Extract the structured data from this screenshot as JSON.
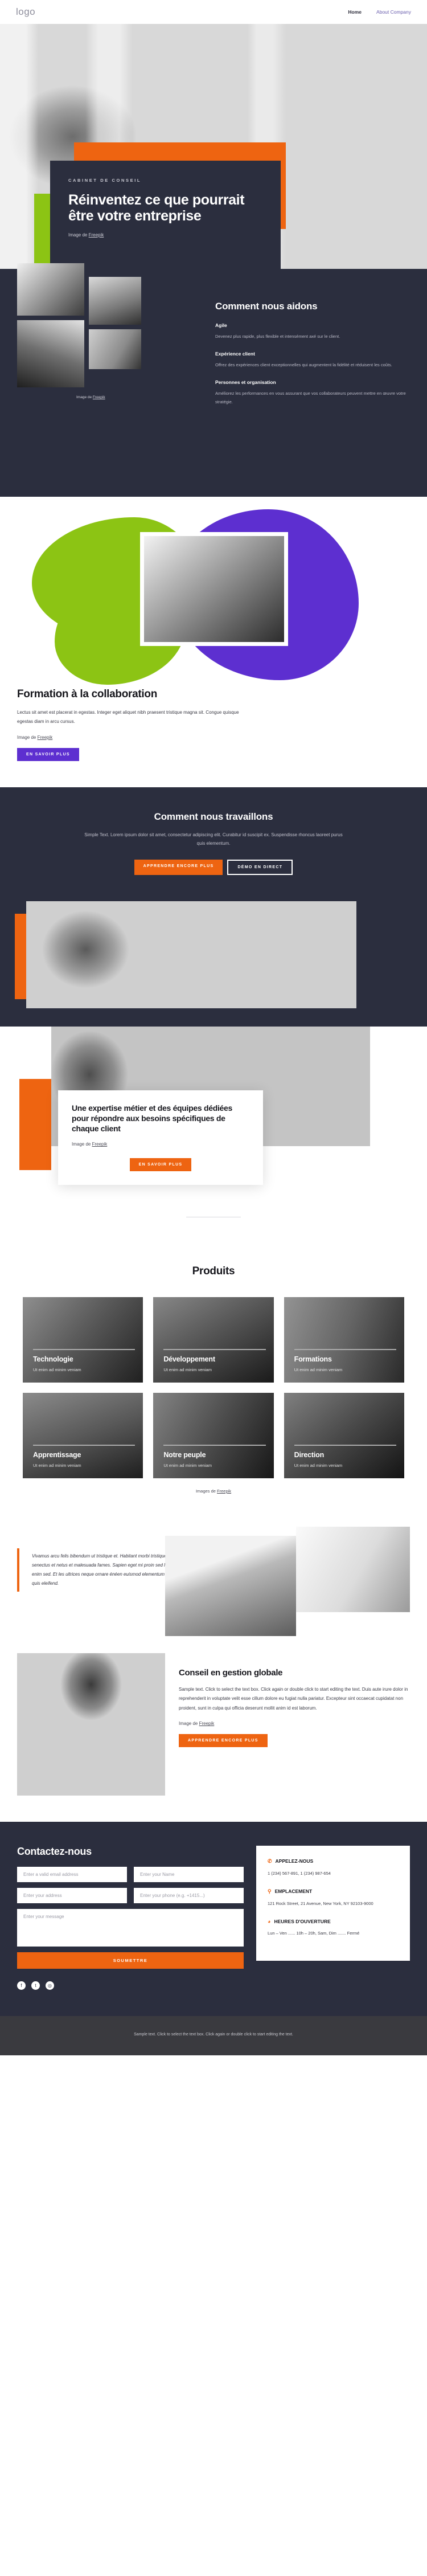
{
  "nav": {
    "logo": "logo",
    "links": [
      {
        "label": "Home"
      },
      {
        "label": "About Company"
      }
    ]
  },
  "hero": {
    "eyebrow": "CABINET DE CONSEIL",
    "title": "Réinventez ce que pourrait être votre entreprise",
    "credit_prefix": "Image de ",
    "credit_link": "Freepik"
  },
  "help": {
    "title": "Comment nous aidons",
    "credit_prefix": "Image de ",
    "credit_link": "Freepik",
    "features": [
      {
        "title": "Agile",
        "text": "Devenez plus rapide, plus flexible et intensément axé sur le client."
      },
      {
        "title": "Expérience client",
        "text": "Offrez des expériences client exceptionnelles qui augmentent la fidélité et réduisent les coûts."
      },
      {
        "title": "Personnes et organisation",
        "text": "Améliorez les performances en vous assurant que vos collaborateurs peuvent mettre en œuvre votre stratégie."
      }
    ]
  },
  "training": {
    "title": "Formation à la collaboration",
    "text": "Lectus sit amet est placerat in egestas. Integer eget aliquet nibh praesent tristique magna sit. Congue quisque egestas diam in arcu cursus.",
    "credit_prefix": "Image de ",
    "credit_link": "Freepik",
    "cta": "EN SAVOIR PLUS"
  },
  "work": {
    "title": "Comment nous travaillons",
    "lead": "Simple Text. Lorem ipsum dolor sit amet, consectetur adipiscing elit. Curabitur id suscipit ex. Suspendisse rhoncus laoreet purus quis elementum.",
    "cta_primary": "APPRENDRE ENCORE PLUS",
    "cta_secondary": "DÉMO EN DIRECT"
  },
  "expertise": {
    "title": "Une expertise métier et des équipes dédiées pour répondre aux besoins spécifiques de chaque client",
    "credit_prefix": "Image de ",
    "credit_link": "Freepik",
    "cta": "EN SAVOIR PLUS"
  },
  "products": {
    "title": "Produits",
    "credit_prefix": "Images de ",
    "credit_link": "Freepik",
    "items": [
      {
        "title": "Technologie",
        "text": "Ut enim ad minim veniam"
      },
      {
        "title": "Développement",
        "text": "Ut enim ad minim veniam"
      },
      {
        "title": "Formations",
        "text": "Ut enim ad minim veniam"
      },
      {
        "title": "Apprentissage",
        "text": "Ut enim ad minim veniam"
      },
      {
        "title": "Notre peuple",
        "text": "Ut enim ad minim veniam"
      },
      {
        "title": "Direction",
        "text": "Ut enim ad minim veniam"
      }
    ]
  },
  "quote": {
    "text": "Vivamus arcu felis bibendum ut tristique et. Habitant morbi tristique senectus et netus et malesuada fames. Sapien eget mi proin sed libero enim sed. Et les ultrices neque ornare énéen euismod elementum nisi quis eleifend."
  },
  "advice": {
    "title": "Conseil en gestion globale",
    "text": "Sample text. Click to select the text box. Click again or double click to start editing the text. Duis aute irure dolor in reprehenderit in voluptate velit esse cillum dolore eu fugiat nulla pariatur. Excepteur sint occaecat cupidatat non proident, sunt in culpa qui officia deserunt mollit anim id est laborum.",
    "credit_prefix": "Image de ",
    "credit_link": "Freepik",
    "cta": "APPRENDRE ENCORE PLUS"
  },
  "contact": {
    "title": "Contactez-nous",
    "fields": {
      "email_placeholder": "Enter a valid email address",
      "name_placeholder": "Enter your Name",
      "address_placeholder": "Enter your address",
      "phone_placeholder": "Enter your phone (e.g. +1415...)",
      "message_placeholder": "Enter your message"
    },
    "submit": "SOUMETTRE",
    "socials": [
      {
        "name": "facebook",
        "glyph": "f"
      },
      {
        "name": "twitter",
        "glyph": "t"
      },
      {
        "name": "instagram",
        "glyph": "◎"
      }
    ],
    "info": [
      {
        "icon": "phone-icon",
        "glyph": "✆",
        "title": "APPELEZ-NOUS",
        "value": "1 (234) 567-891, 1 (234) 987-654"
      },
      {
        "icon": "location-pin-icon",
        "glyph": "⚲",
        "title": "EMPLACEMENT",
        "value": "121 Rock Street, 21 Avenue, New York, NY 92103-9000"
      },
      {
        "icon": "clock-icon",
        "glyph": "◕",
        "title": "HEURES D'OUVERTURE",
        "value": "Lun – Ven ...... 10h – 20h, Sam, Dim ....... Fermé"
      }
    ]
  },
  "footer": {
    "text": "Sample text. Click to select the text box. Click again or double click to start editing the text."
  },
  "colors": {
    "orange": "#ee6411",
    "green": "#8cc414",
    "purple": "#5d2fd0",
    "dark": "#2b2e3e",
    "footer_dark": "#3a3a3f"
  }
}
